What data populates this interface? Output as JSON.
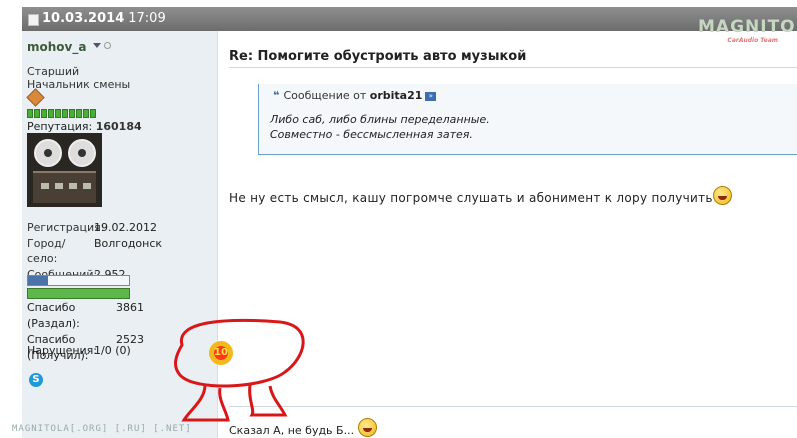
{
  "post_header": {
    "date": "10.03.2014",
    "time": "17:09"
  },
  "watermark": {
    "logo": "MAGNITOLA",
    "logo_sub": "CarAudio Team",
    "bottom": "MAGNITOLA[.ORG] [.RU] [.NET]"
  },
  "user": {
    "name": "mohov_a",
    "rank_line1": "Старший",
    "rank_line2": "Начальник смены",
    "reputation_label": "Репутация:",
    "reputation_value": "160184",
    "reputation_bar_segments": 10,
    "stats": [
      {
        "key": "Регистрация:",
        "value": "19.02.2012"
      },
      {
        "key": "Город/село:",
        "value": "Волгодонск"
      },
      {
        "key": "Сообщений:",
        "value": "2,952"
      }
    ],
    "thanks": [
      {
        "key": "Спасибо (Раздал):",
        "value": "3861"
      },
      {
        "key": "Спасибо (Получил):",
        "value": "2523"
      }
    ],
    "violations_label": "Нарушения:",
    "violations_value": "1/0 (0)",
    "progress_blue": 0.2,
    "progress_green": 1.0,
    "colors": {
      "rep_bar": "#4cae37",
      "progress_blue": "#4b73a7",
      "progress_green": "#5cb84a"
    }
  },
  "post": {
    "title": "Re: Помогите обустроить авто музыкой",
    "quote": {
      "prefix": "Сообщение от",
      "author": "orbita21",
      "line1": "Либо саб, либо блины переделанные.",
      "line2": "Совместно - бессмысленная затея."
    },
    "message": "Не ну есть смысл, кашу погромче слушать и абонимент к лору получить",
    "signature": "Сказал А, не будь Б..."
  },
  "medal_text": "10"
}
